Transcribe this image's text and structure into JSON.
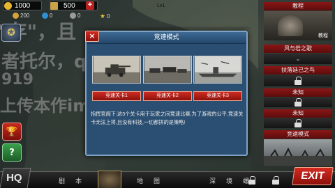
{
  "resources": {
    "gold": "1000",
    "medals": "500",
    "coin_a": "200",
    "coin_b": "0",
    "coin_c": "0",
    "stars": "0",
    "level": "Lv1"
  },
  "watermark": {
    "line1": "\"存\"，且",
    "line2": "者托尔，q",
    "line3": "919",
    "line4": "上传本作im"
  },
  "right_panel": {
    "tutorial_header": "教程",
    "tutorial_button": "教程",
    "items": [
      {
        "label": "风与岩之歌"
      },
      {
        "label": "扶落廷己之鸟"
      },
      {
        "label": "未知"
      },
      {
        "label": "未知"
      },
      {
        "label": "竞速模式"
      }
    ]
  },
  "modal": {
    "title": "竞速模式",
    "close_label": "×",
    "stages": [
      {
        "label": "竞速关卡1"
      },
      {
        "label": "竞速关卡2"
      },
      {
        "label": "竞速关卡3"
      }
    ],
    "description": "指挥官阁下:这3个关卡用于玩家之间竞速比赛,为了游戏的公平,竞速关卡无法上将,且没有科技,一切都拼的是策略!"
  },
  "bottom_nav": {
    "hq": "HQ",
    "campaign": "剧　本",
    "map": "地　图",
    "deep": "深　境　螺",
    "exit": "EXIT"
  },
  "colors": {
    "accent_red": "#c8241c",
    "modal_blue": "#2b4f72"
  }
}
